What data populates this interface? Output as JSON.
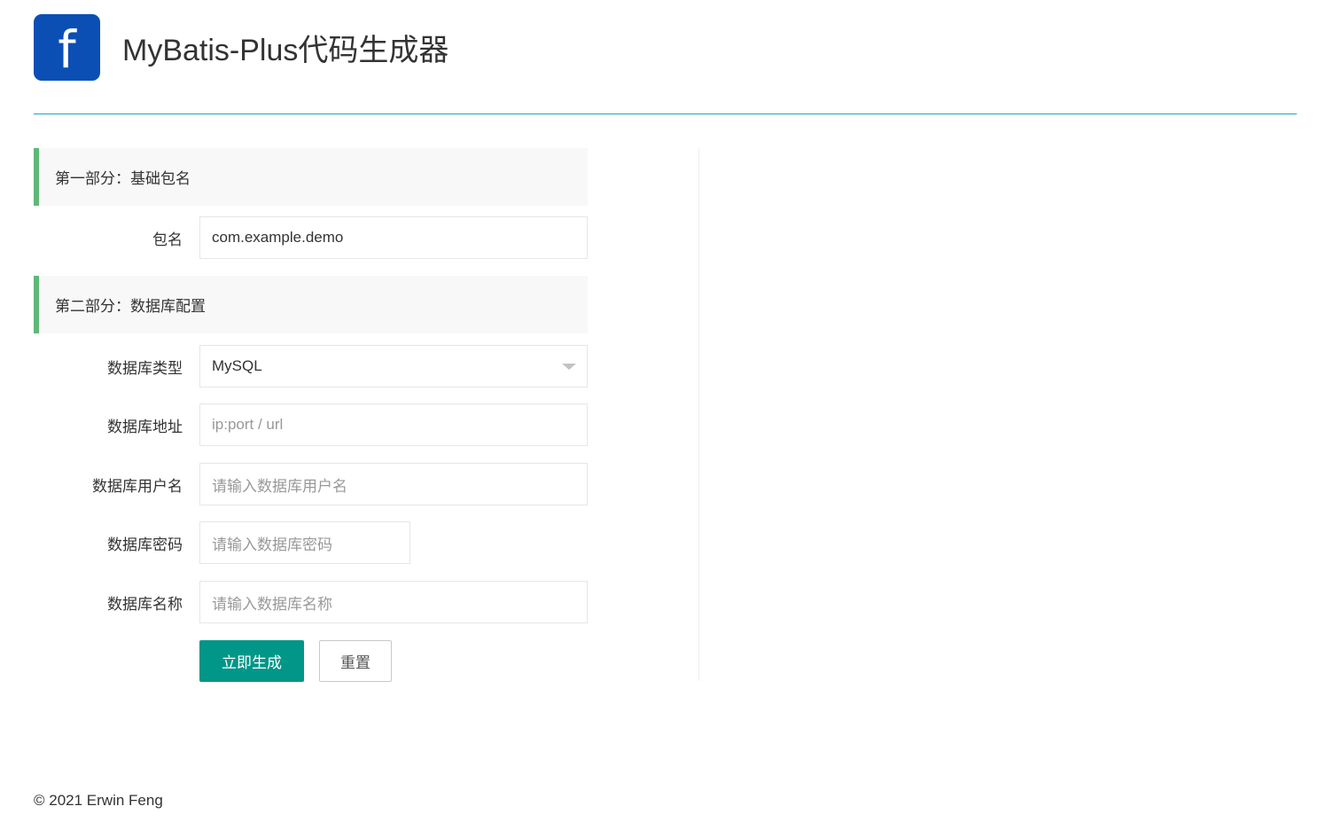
{
  "header": {
    "logo_letter": "f",
    "title": "MyBatis-Plus代码生成器"
  },
  "sections": {
    "part1_title": "第一部分：基础包名",
    "part2_title": "第二部分：数据库配置"
  },
  "form": {
    "package": {
      "label": "包名",
      "value": "com.example.demo"
    },
    "db_type": {
      "label": "数据库类型",
      "value": "MySQL"
    },
    "db_url": {
      "label": "数据库地址",
      "placeholder": "ip:port / url"
    },
    "db_user": {
      "label": "数据库用户名",
      "placeholder": "请输入数据库用户名"
    },
    "db_password": {
      "label": "数据库密码",
      "placeholder": "请输入数据库密码"
    },
    "db_name": {
      "label": "数据库名称",
      "placeholder": "请输入数据库名称"
    }
  },
  "buttons": {
    "submit": "立即生成",
    "reset": "重置"
  },
  "footer": {
    "copyright": "© 2021 Erwin Feng"
  },
  "colors": {
    "logo_bg": "#0b4fb4",
    "header_rule": "#1e9fc8",
    "section_accent": "#5fb878",
    "primary_button": "#009688"
  }
}
